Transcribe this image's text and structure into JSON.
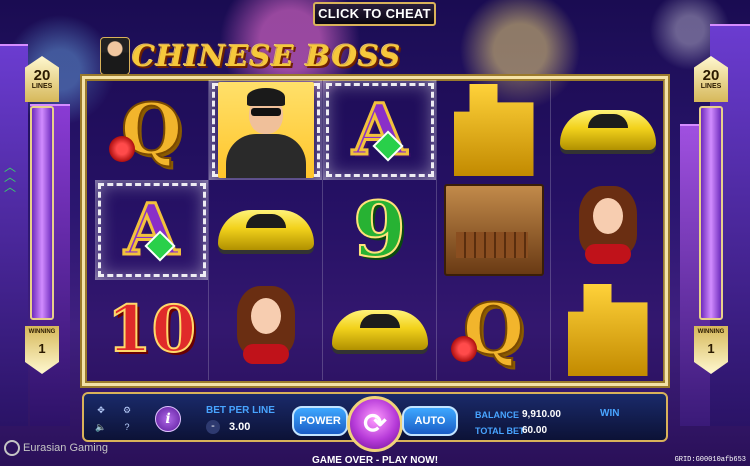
{
  "header": {
    "cheat_button": "CLICK TO CHEAT",
    "logo_text": "CHINESE BOSS"
  },
  "lines": {
    "value": "20",
    "label": "LINES"
  },
  "winning": {
    "label": "WINNING",
    "value": "1"
  },
  "reels": [
    [
      "Q",
      "A",
      "10"
    ],
    [
      "boss",
      "car",
      "lady"
    ],
    [
      "A",
      "9",
      "car"
    ],
    [
      "buildings",
      "cigar-box",
      "Q"
    ],
    [
      "car",
      "lady",
      "buildings"
    ]
  ],
  "controls": {
    "bet_per_line_label": "BET PER LINE",
    "bet_minus": "-",
    "bet_per_line_value": "3.00",
    "info_label": "i",
    "power_label": "POWER",
    "auto_label": "AUTO",
    "balance_label": "BALANCE",
    "balance_value": "9,910.00",
    "total_bet_label": "TOTAL BET",
    "total_bet_value": "60.00",
    "win_label": "WIN"
  },
  "footer": {
    "brand": "Eurasian Gaming",
    "game_over": "GAME OVER - PLAY NOW!",
    "grid_id": "GRID:G00010afb653"
  },
  "icons": {
    "fullscreen": "fullscreen-icon",
    "settings": "gear-icon",
    "sound": "speaker-icon",
    "help": "help-icon",
    "spin": "spin-arrows-icon"
  }
}
